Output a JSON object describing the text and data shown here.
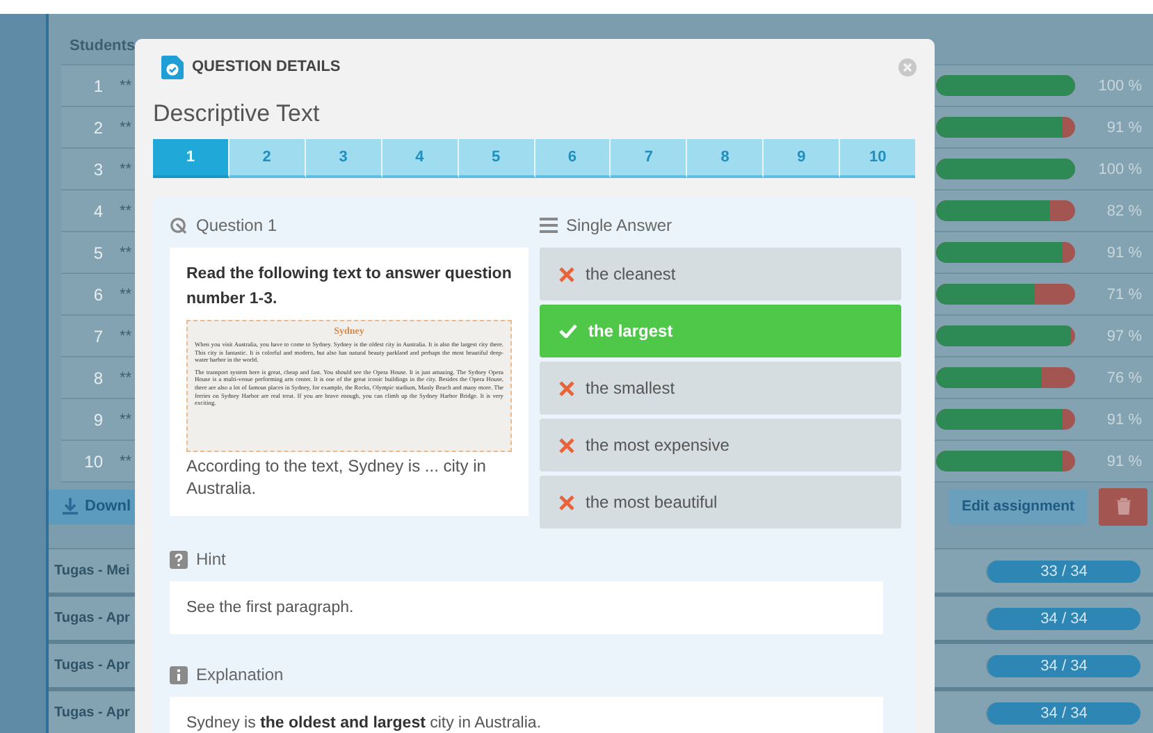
{
  "app": {
    "table": {
      "header": "Students",
      "rows": [
        {
          "number": "1",
          "name": "**",
          "level": 1.0,
          "percent": "100 %"
        },
        {
          "number": "2",
          "name": "**",
          "level": 0.91,
          "percent": "91 %"
        },
        {
          "number": "3",
          "name": "**",
          "level": 1.0,
          "percent": "100 %"
        },
        {
          "number": "4",
          "name": "**",
          "level": 0.82,
          "percent": "82 %"
        },
        {
          "number": "5",
          "name": "**",
          "level": 0.91,
          "percent": "91 %"
        },
        {
          "number": "6",
          "name": "**",
          "level": 0.71,
          "percent": "71 %"
        },
        {
          "number": "7",
          "name": "**",
          "level": 0.97,
          "percent": "97 %"
        },
        {
          "number": "8",
          "name": "**",
          "level": 0.76,
          "percent": "76 %"
        },
        {
          "number": "9",
          "name": "**",
          "level": 0.91,
          "percent": "91 %"
        },
        {
          "number": "10",
          "name": "**",
          "level": 0.91,
          "percent": "91 %"
        }
      ]
    },
    "download_button": "Downl",
    "edit_button": "Edit assignment",
    "assignments": [
      {
        "title": "Tugas - Mei",
        "count": "33 / 34"
      },
      {
        "title": "Tugas - Apr",
        "count": "34 / 34"
      },
      {
        "title": "Tugas - Apr",
        "count": "34 / 34"
      },
      {
        "title": "Tugas - Apr",
        "count": "34 / 34"
      }
    ]
  },
  "dialog": {
    "title": "QUESTION DETAILS",
    "heading": "Descriptive Text",
    "tabs": [
      {
        "label": "1",
        "selected": true
      },
      {
        "label": "2",
        "selected": false
      },
      {
        "label": "3",
        "selected": false
      },
      {
        "label": "4",
        "selected": false
      },
      {
        "label": "5",
        "selected": false
      },
      {
        "label": "6",
        "selected": false
      },
      {
        "label": "7",
        "selected": false
      },
      {
        "label": "8",
        "selected": false
      },
      {
        "label": "9",
        "selected": false
      },
      {
        "label": "10",
        "selected": false
      }
    ],
    "question": {
      "label": "Question 1",
      "prompt": "Read the following text to answer question number 1-3.",
      "passage": {
        "title": "Sydney",
        "paragraphs": [
          "When you visit Australia, you have to come to Sydney. Sydney is the oldest city in Australia. It is also the largest city there. This city is fantastic. It is colorful and modern, but also has natural beauty parkland and perhaps the most beautiful deep-water harbor in the world.",
          "The transport system here is great, cheap and fast. You should see the Opera House. It is just amazing. The Sydney Opera House is a multi-venue performing arts center. It is one of the great iconic buildings in the city. Besides the Opera House, there are also a lot of famous places in Sydney, for example, the Rocks, Olympic stadium, Manly Beach and many more. The ferries on Sydney Harbor are real treat. If you are brave enough, you can climb up the Sydney Harbor Bridge. It is very exciting."
        ]
      },
      "stem": "According to the text, Sydney is ... city in Australia."
    },
    "answers": {
      "label": "Single Answer",
      "options": [
        {
          "text": "the cleanest",
          "correct": false
        },
        {
          "text": "the largest",
          "correct": true
        },
        {
          "text": "the smallest",
          "correct": false
        },
        {
          "text": "the most expensive",
          "correct": false
        },
        {
          "text": "the most beautiful",
          "correct": false
        }
      ]
    },
    "hint": {
      "label": "Hint",
      "text": "See the first paragraph."
    },
    "explanation": {
      "label": "Explanation",
      "text": "Sydney is **the oldest and largest** city in Australia."
    }
  }
}
